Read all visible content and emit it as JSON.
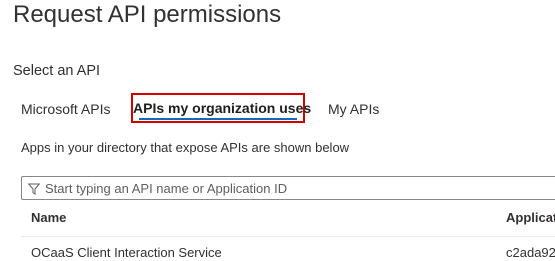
{
  "page": {
    "title": "Request API permissions",
    "section_label": "Select an API"
  },
  "tabs": [
    {
      "label": "Microsoft APIs",
      "selected": false
    },
    {
      "label": "APIs my organization uses",
      "selected": true,
      "highlighted": true
    },
    {
      "label": "My APIs",
      "selected": false
    }
  ],
  "description": "Apps in your directory that expose APIs are shown below",
  "search": {
    "placeholder": "Start typing an API name or Application ID",
    "value": "",
    "icon": "filter-icon"
  },
  "table": {
    "columns": [
      "Name",
      "Applicat"
    ],
    "rows": [
      {
        "name": "OCaaS Client Interaction Service",
        "app_id": "c2ada92"
      }
    ]
  },
  "colors": {
    "highlight_border": "#d00000",
    "accent": "#0f6cbd",
    "text": "#323130"
  }
}
